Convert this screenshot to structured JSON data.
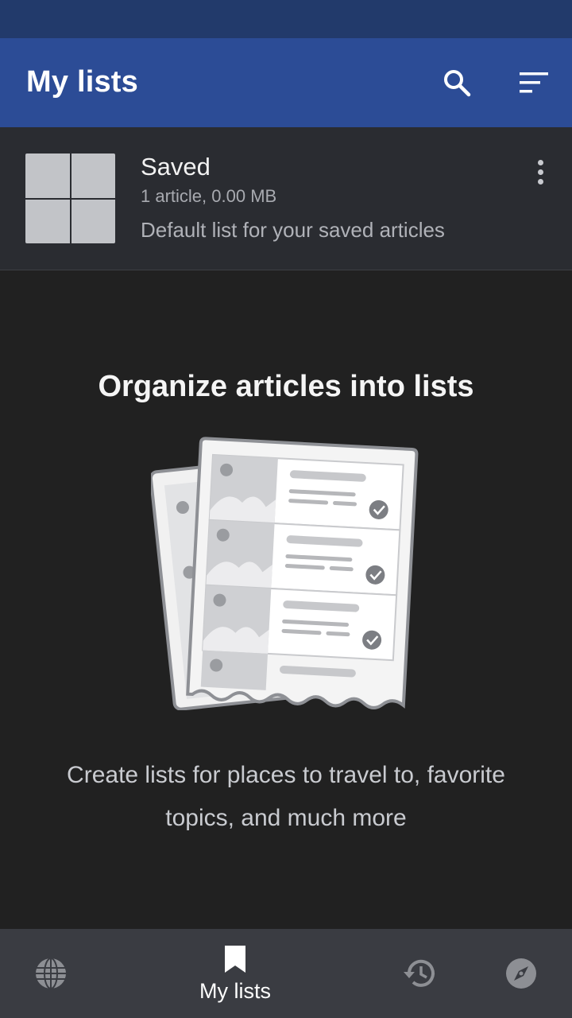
{
  "app": {
    "title": "My lists"
  },
  "toolbar": {
    "search_icon": "search-icon",
    "sort_icon": "sort-icon"
  },
  "reading_lists": [
    {
      "title": "Saved",
      "meta": "1 article, 0.00 MB",
      "description": "Default list for your saved articles"
    }
  ],
  "empty_state": {
    "title": "Organize articles into lists",
    "description": "Create lists for places to travel to, favorite topics, and much more"
  },
  "bottom_nav": {
    "items": [
      {
        "icon": "globe-icon",
        "label": ""
      },
      {
        "icon": "bookmark-icon",
        "label": "My lists"
      },
      {
        "icon": "history-icon",
        "label": ""
      },
      {
        "icon": "compass-icon",
        "label": ""
      }
    ],
    "active": "My lists"
  },
  "colors": {
    "statusbar": "#223a6b",
    "appbar": "#2c4c96",
    "background": "#212121",
    "list_row": "#2a2c31",
    "bottom_nav": "#3a3c42"
  }
}
